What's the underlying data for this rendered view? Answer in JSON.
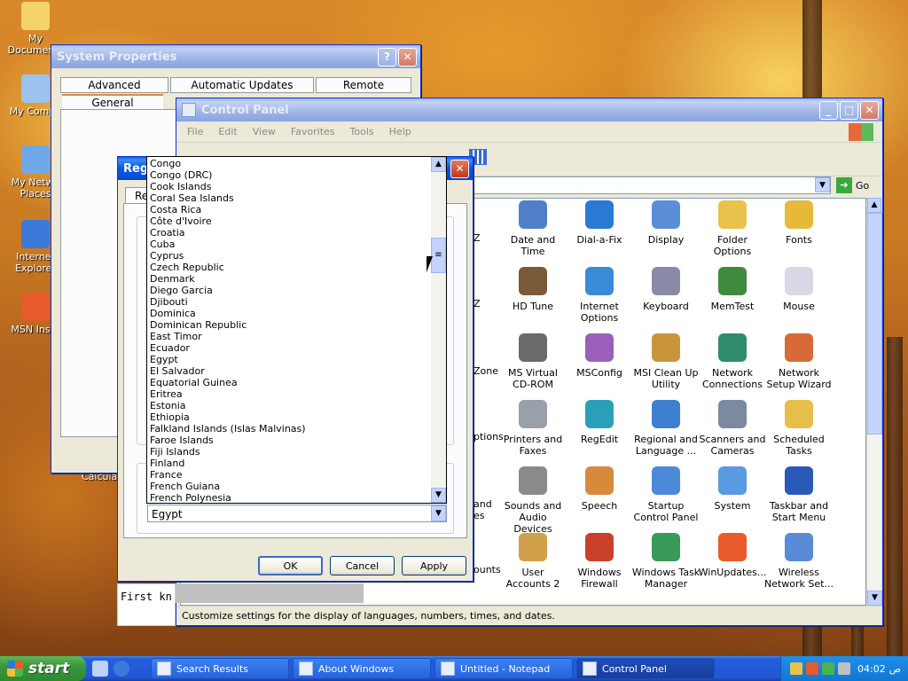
{
  "desktop": {
    "icons": [
      {
        "label": "My Documents",
        "icon": "my-documents-icon",
        "color": "#f4d36a"
      },
      {
        "label": "My Compu",
        "icon": "my-computer-icon",
        "color": "#9cc2f0"
      },
      {
        "label": "My Netwo\nPlaces",
        "icon": "network-places-icon",
        "color": "#6fa8e8"
      },
      {
        "label": "Internet\nExplorer",
        "icon": "internet-explorer-icon",
        "color": "#3b7ad8"
      },
      {
        "label": "MSN Insta",
        "icon": "msn-icon",
        "color": "#e85a2a"
      }
    ],
    "calc_label": "Calculat"
  },
  "system_properties": {
    "title": "System Properties",
    "tabs_row1": [
      "Advanced",
      "Automatic Updates",
      "Remote"
    ],
    "tab_general": "General"
  },
  "control_panel": {
    "title": "Control Panel",
    "menu": [
      "File",
      "Edit",
      "View",
      "Favorites",
      "Tools",
      "Help"
    ],
    "go_label": "Go",
    "status": "Customize settings for the display of languages, numbers, times, and dates.",
    "items": [
      {
        "label": "Date and Time",
        "icon": "clock-icon",
        "color": "#4f7fc9"
      },
      {
        "label": "Dial-a-Fix",
        "icon": "gear-icon",
        "color": "#2a79d4"
      },
      {
        "label": "Display",
        "icon": "display-icon",
        "color": "#5a8fd8"
      },
      {
        "label": "Folder Options",
        "icon": "folder-icon",
        "color": "#e8c24a"
      },
      {
        "label": "Fonts",
        "icon": "fonts-folder-icon",
        "color": "#e6b93a"
      },
      {
        "label": "HD Tune",
        "icon": "hard-disk-icon",
        "color": "#7b5a3a"
      },
      {
        "label": "Internet Options",
        "icon": "globe-icon",
        "color": "#3a8ad6"
      },
      {
        "label": "Keyboard",
        "icon": "keyboard-icon",
        "color": "#8a8aa8"
      },
      {
        "label": "MemTest",
        "icon": "memory-icon",
        "color": "#3f8a3f"
      },
      {
        "label": "Mouse",
        "icon": "mouse-icon",
        "color": "#d8d8e6"
      },
      {
        "label": "MS Virtual CD-ROM",
        "icon": "cd-icon",
        "color": "#6a6a6a"
      },
      {
        "label": "MSConfig",
        "icon": "tools-icon",
        "color": "#9a5fb8"
      },
      {
        "label": "MSI Clean Up Utility",
        "icon": "broom-icon",
        "color": "#c9953a"
      },
      {
        "label": "Network Connections",
        "icon": "network-globe-icon",
        "color": "#2f8c6a"
      },
      {
        "label": "Network Setup Wizard",
        "icon": "house-icon",
        "color": "#d86a3a"
      },
      {
        "label": "Printers and Faxes",
        "icon": "printer-icon",
        "color": "#9aa0aa"
      },
      {
        "label": "RegEdit",
        "icon": "registry-icon",
        "color": "#2aa0b8"
      },
      {
        "label": "Regional and Language ...",
        "icon": "regional-globe-icon",
        "color": "#3f7fd0"
      },
      {
        "label": "Scanners and Cameras",
        "icon": "scanner-icon",
        "color": "#7a8aa0"
      },
      {
        "label": "Scheduled Tasks",
        "icon": "scheduled-folder-icon",
        "color": "#e6be4a"
      },
      {
        "label": "Sounds and Audio Devices",
        "icon": "speaker-icon",
        "color": "#8a8a8a"
      },
      {
        "label": "Speech",
        "icon": "speech-icon",
        "color": "#d88a3a"
      },
      {
        "label": "Startup Control Panel",
        "icon": "startup-icon",
        "color": "#4a8ad8"
      },
      {
        "label": "System",
        "icon": "system-icon",
        "color": "#5a9ae0"
      },
      {
        "label": "Taskbar and Start Menu",
        "icon": "taskbar-icon",
        "color": "#2a5ab8"
      },
      {
        "label": "User Accounts 2",
        "icon": "users-icon",
        "color": "#d0a04a"
      },
      {
        "label": "Windows Firewall",
        "icon": "firewall-icon",
        "color": "#c8402a"
      },
      {
        "label": "Windows Task Manager",
        "icon": "task-manager-icon",
        "color": "#3a9a5a"
      },
      {
        "label": "WinUpdates...",
        "icon": "windows-logo-icon",
        "color": "#e85a2a"
      },
      {
        "label": "Wireless Network Set...",
        "icon": "wireless-icon",
        "color": "#5a8ad8"
      }
    ],
    "partial_left": [
      "Z",
      "Z",
      "Zone",
      "ptions",
      "and\nes",
      "ounts"
    ]
  },
  "regional_dialog": {
    "title": "Regio",
    "tab_partial": "Reg",
    "ok": "OK",
    "cancel": "Cancel",
    "apply": "Apply",
    "selected": "Egypt",
    "countries": [
      "Congo",
      "Congo (DRC)",
      "Cook Islands",
      "Coral Sea Islands",
      "Costa Rica",
      "Côte d'Ivoire",
      "Croatia",
      "Cuba",
      "Cyprus",
      "Czech Republic",
      "Denmark",
      "Diego Garcia",
      "Djibouti",
      "Dominica",
      "Dominican Republic",
      "East Timor",
      "Ecuador",
      "Egypt",
      "El Salvador",
      "Equatorial Guinea",
      "Eritrea",
      "Estonia",
      "Ethiopia",
      "Falkland Islands (Islas Malvinas)",
      "Faroe Islands",
      "Fiji Islands",
      "Finland",
      "France",
      "French Guiana",
      "French Polynesia"
    ],
    "first_text": "First kn"
  },
  "taskbar": {
    "start": "start",
    "tasks": [
      "Search Results",
      "About Windows",
      "Untitled - Notepad",
      "Control Panel"
    ],
    "clock": "04:02",
    "ampm": "ص"
  }
}
